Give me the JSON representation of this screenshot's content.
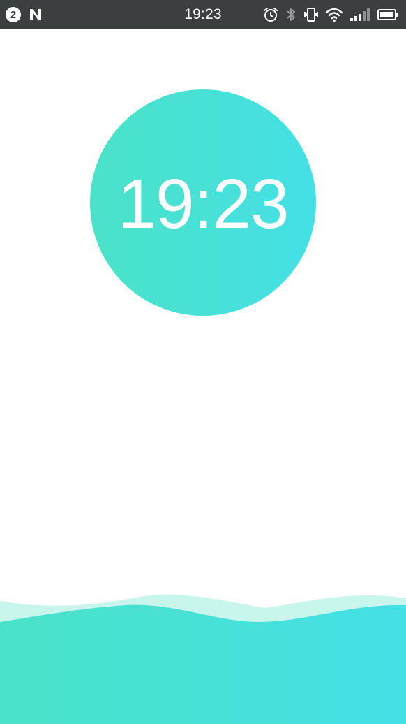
{
  "status_bar": {
    "notification_count": "2",
    "time": "19:23",
    "icons": [
      "notification-count-icon",
      "n-logo-icon",
      "alarm-icon",
      "bluetooth-icon",
      "vibrate-icon",
      "wifi-icon",
      "signal-icon",
      "battery-icon"
    ]
  },
  "clock": {
    "time": "19:23"
  },
  "colors": {
    "status_bar_bg": "#3c3f3f",
    "accent_start": "#4ae2c7",
    "accent_end": "#44e0e6",
    "wave_light": "#c8f5ec",
    "background": "#fefffe"
  }
}
